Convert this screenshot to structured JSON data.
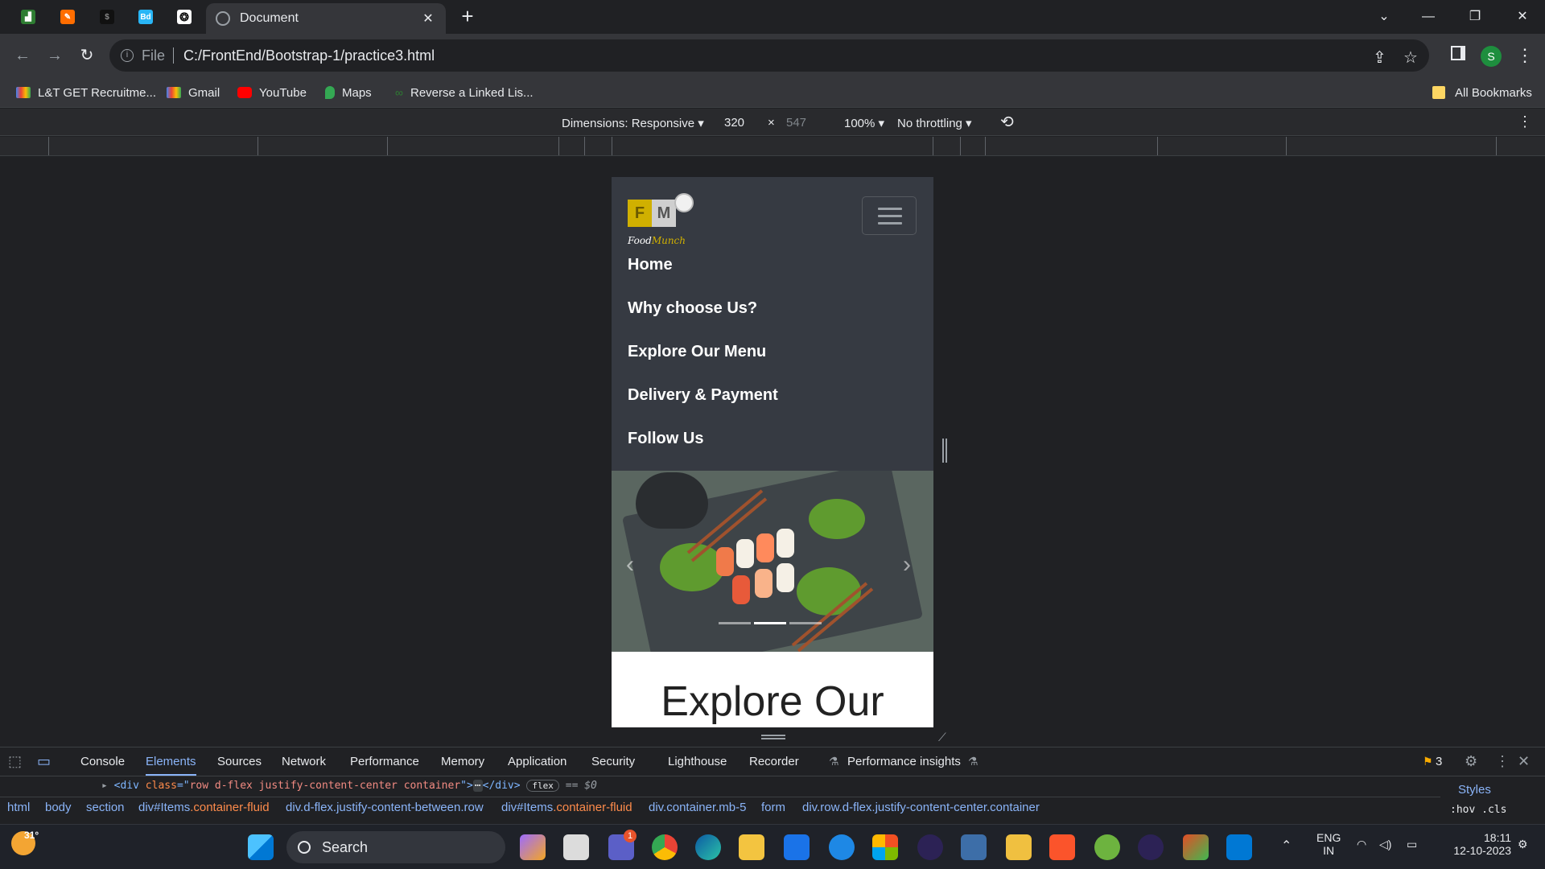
{
  "browser": {
    "pinned_tabs": [
      {
        "icon": "chart-app-icon",
        "color": "#2e7d32",
        "glyph": "▟"
      },
      {
        "icon": "pencil-app-icon",
        "color": "#ff6d00",
        "glyph": "✎"
      },
      {
        "icon": "dark-app-icon",
        "color": "#111111",
        "glyph": "$"
      },
      {
        "icon": "bd-app-icon",
        "color": "#29b6f6",
        "glyph": "Bd"
      },
      {
        "icon": "openai-icon",
        "color": "#ffffff",
        "glyph": "❂"
      }
    ],
    "active_tab": {
      "title": "Document"
    },
    "url": {
      "scheme": "File",
      "path": "C:/FrontEnd/Bootstrap-1/practice3.html"
    },
    "profile_initial": "S",
    "bookmarks": [
      {
        "label": "L&T GET Recruitme...",
        "icon": "gmail-icon"
      },
      {
        "label": "Gmail",
        "icon": "gmail-icon"
      },
      {
        "label": "YouTube",
        "icon": "youtube-icon"
      },
      {
        "label": "Maps",
        "icon": "maps-pin-icon"
      },
      {
        "label": "Reverse a Linked Lis...",
        "icon": "link-icon"
      }
    ],
    "all_bookmarks": "All Bookmarks"
  },
  "device_toolbar": {
    "dimensions": "Dimensions: Responsive",
    "width": "320",
    "times": "×",
    "height": "547",
    "zoom": "100%",
    "throttling": "No throttling"
  },
  "site": {
    "logo": {
      "f": "F",
      "m": "M",
      "text_a": "Food",
      "text_b": "Munch"
    },
    "nav_links": [
      "Home",
      "Why choose Us?",
      "Explore Our Menu",
      "Delivery & Payment",
      "Follow Us"
    ],
    "carousel": {
      "prev": "‹",
      "next": "›",
      "active_index": 1,
      "count": 3
    },
    "section_heading": "Explore Our"
  },
  "devtools": {
    "tabs": [
      "Console",
      "Elements",
      "Sources",
      "Network",
      "Performance",
      "Memory",
      "Application",
      "Security",
      "Lighthouse",
      "Recorder",
      "Performance insights"
    ],
    "active_tab": "Elements",
    "issues_count": "3",
    "dom_line": {
      "open": "<div ",
      "attr": "class",
      "eq": "=\"",
      "value": "row d-flex justify-content-center container",
      "close": "\">",
      "ellipsis": "⋯",
      "end": "</div>",
      "badge": "flex",
      "ref": "== $0"
    },
    "breadcrumbs": [
      {
        "tag": "html",
        "cls": ""
      },
      {
        "tag": "body",
        "cls": ""
      },
      {
        "tag": "section",
        "cls": ""
      },
      {
        "tag": "div#Items",
        "cls": ".container-fluid"
      },
      {
        "tag": "div.d-flex.justify-content-between.row",
        "cls": ""
      },
      {
        "tag": "div#Items",
        "cls": ".container-fluid"
      },
      {
        "tag": "div.container.mb-5",
        "cls": ""
      },
      {
        "tag": "form",
        "cls": ""
      },
      {
        "tag": "div.row.d-flex.justify-content-center.container",
        "cls": ""
      }
    ],
    "styles_tab": "Styles",
    "styles_filters": ":hov .cls"
  },
  "taskbar": {
    "weather_temp": "31°",
    "search_label": "Search",
    "lang": "ENG",
    "region": "IN",
    "time": "18:11",
    "date": "12-10-2023",
    "teams_badge": "1"
  }
}
